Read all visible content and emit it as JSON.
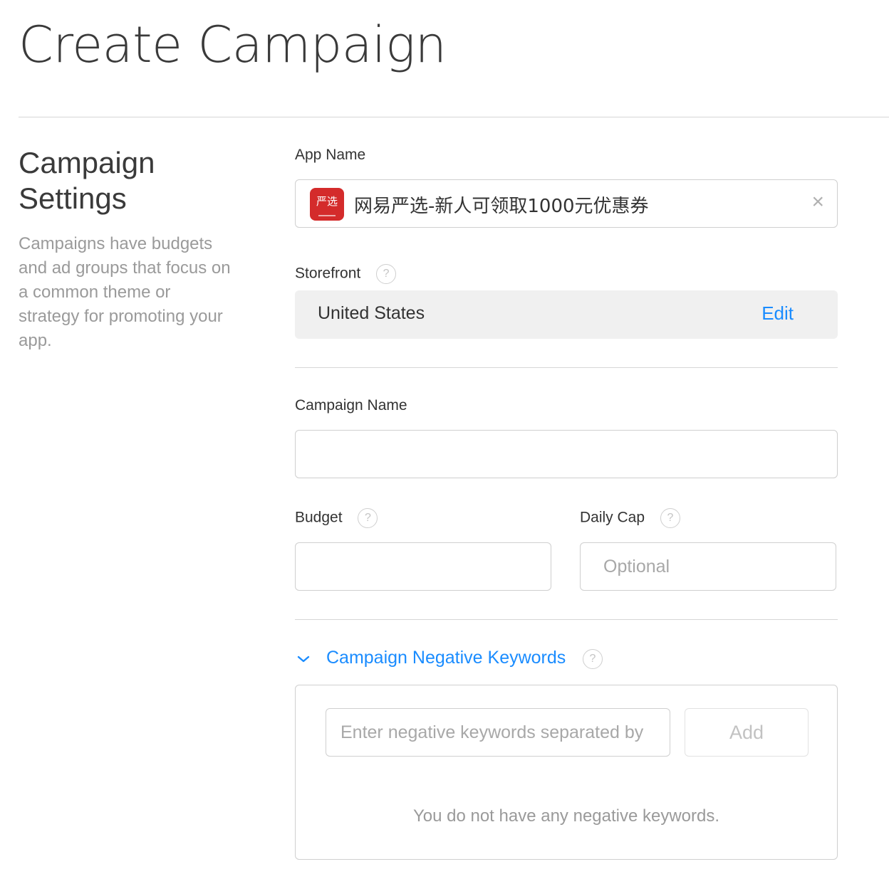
{
  "page": {
    "title": "Create Campaign"
  },
  "section": {
    "title_line1": "Campaign",
    "title_line2": "Settings",
    "description": "Campaigns have budgets and ad groups that focus on a common theme or strategy for promoting your app."
  },
  "app": {
    "label": "App Name",
    "value": "网易严选-新人可领取1000元优惠券",
    "icon_text": "严选",
    "icon_color": "#d42b2b",
    "clear_icon": "×"
  },
  "storefront": {
    "label": "Storefront",
    "value": "United States",
    "edit_label": "Edit"
  },
  "help_icon": "?",
  "campaign_name": {
    "label": "Campaign Name",
    "value": "",
    "placeholder": ""
  },
  "budget": {
    "label": "Budget",
    "value": "",
    "placeholder": ""
  },
  "daily_cap": {
    "label": "Daily Cap",
    "value": "",
    "placeholder": "Optional"
  },
  "negative_keywords": {
    "title": "Campaign Negative Keywords",
    "expanded": true,
    "input_placeholder": "Enter negative keywords separated by",
    "add_label": "Add",
    "empty_message": "You do not have any negative keywords."
  },
  "colors": {
    "accent": "#1a8cff",
    "muted": "#9a9a9a",
    "border": "#cfcfcf"
  }
}
